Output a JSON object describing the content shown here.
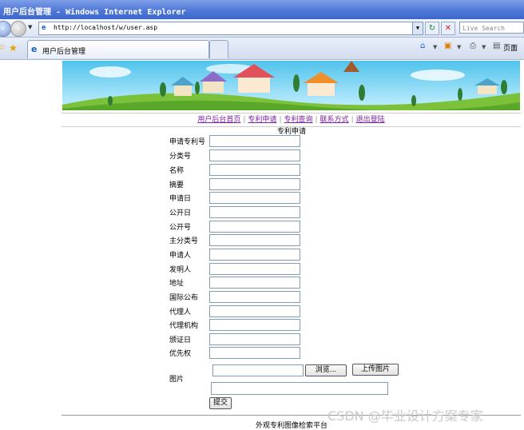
{
  "window": {
    "title": "用户后台管理 - Windows Internet Explorer"
  },
  "address": {
    "url": "http://localhost/w/user.asp",
    "search_placeholder": "Live Search"
  },
  "tab": {
    "label": "用户后台管理"
  },
  "toolbar": {
    "page_label": "页面"
  },
  "nav": {
    "home": "用户后台首页",
    "apply": "专利申请",
    "query": "专利查询",
    "contact": "联系方式",
    "logout": "退出登陆",
    "separator": "|"
  },
  "form": {
    "title": "专利申请",
    "fields": [
      "申请专利号",
      "分类号",
      "名称",
      "摘要",
      "申请日",
      "公开日",
      "公开号",
      "主分类号",
      "申请人",
      "发明人",
      "地址",
      "国际公布",
      "代理人",
      "代理机构",
      "颁证日",
      "优先权"
    ],
    "image_label": "图片",
    "browse_button": "浏览...",
    "upload_button": "上传图片",
    "submit_button": "提交"
  },
  "footer": {
    "text": "外观专利图像检索平台"
  },
  "watermark": "CSDN @毕业设计方案专家"
}
